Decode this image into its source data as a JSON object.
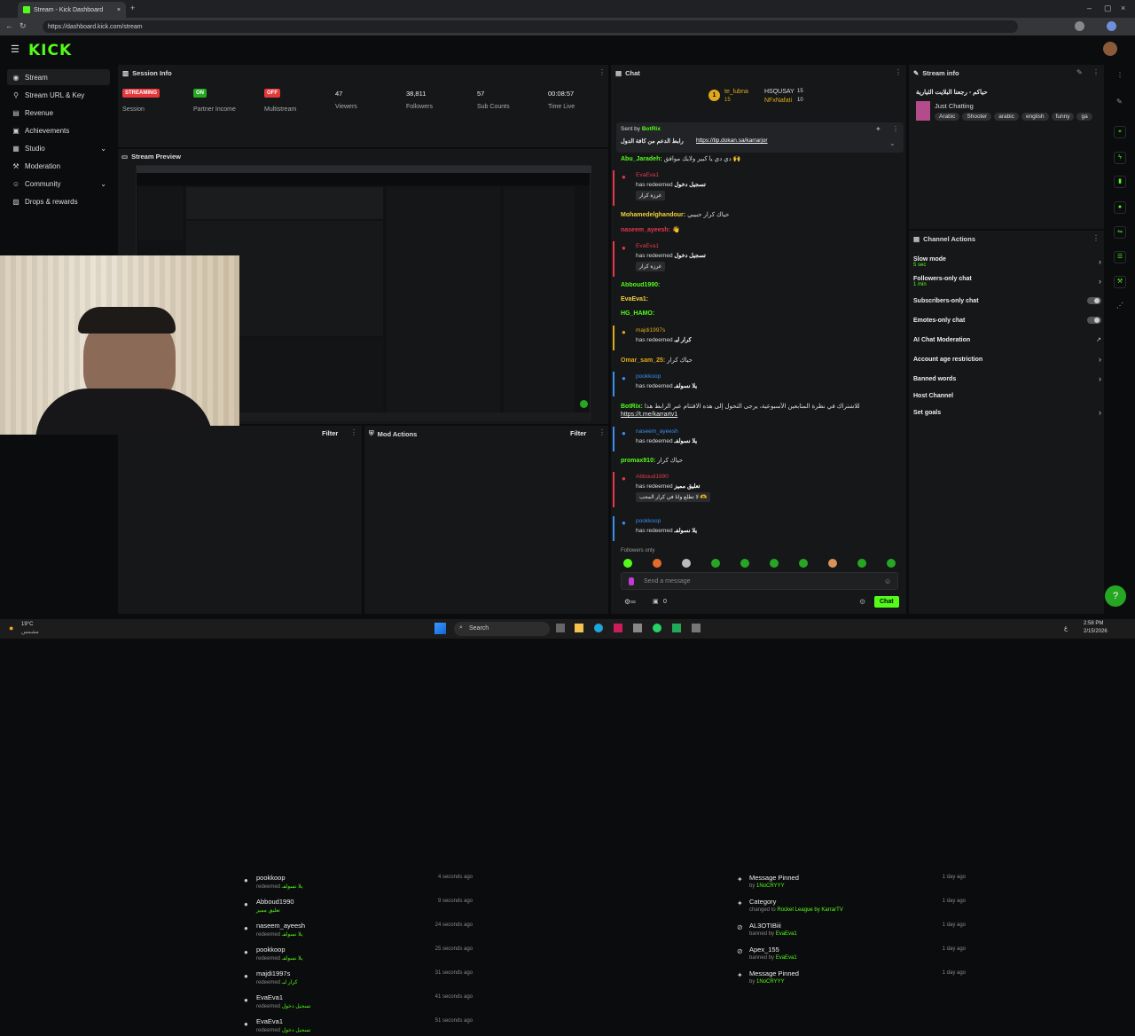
{
  "browser": {
    "tab_title": "Stream - Kick Dashboard",
    "url": "https://dashboard.kick.com/stream"
  },
  "brand": {
    "logo": "KICK",
    "accent": "#53fc18"
  },
  "sidebar": {
    "items": [
      {
        "label": "Stream",
        "icon": "broadcast-icon"
      },
      {
        "label": "Stream URL & Key",
        "icon": "link-icon"
      },
      {
        "label": "Revenue",
        "icon": "money-icon"
      },
      {
        "label": "Achievements",
        "icon": "trophy-icon"
      },
      {
        "label": "Studio",
        "icon": "studio-icon"
      },
      {
        "label": "Moderation",
        "icon": "shield-icon"
      },
      {
        "label": "Community",
        "icon": "people-icon"
      },
      {
        "label": "Drops & rewards",
        "icon": "gift-icon"
      }
    ]
  },
  "session": {
    "title": "Session Info",
    "stats": [
      {
        "badge": "STREAMING",
        "label": "Session"
      },
      {
        "badge": "ON",
        "label": "Partner Income"
      },
      {
        "badge": "OFF",
        "label": "Multistream"
      },
      {
        "value": "47",
        "label": "Viewers"
      },
      {
        "value": "38,811",
        "label": "Followers"
      },
      {
        "value": "57",
        "label": "Sub Counts"
      },
      {
        "value": "00:08:57",
        "label": "Time Live"
      }
    ]
  },
  "preview": {
    "title": "Stream Preview"
  },
  "activity": {
    "filter": "Filter",
    "items": [
      {
        "name": "pookkoop",
        "sub": "redeemed",
        "reward": "يلا نسولفـ",
        "time": "4 seconds ago"
      },
      {
        "name": "Abboud1990",
        "sub": "",
        "reward": "تعليق مميز",
        "time": "9 seconds ago"
      },
      {
        "name": "naseem_ayeesh",
        "sub": "redeemed",
        "reward": "يلا نسولفـ",
        "time": "24 seconds ago"
      },
      {
        "name": "pookkoop",
        "sub": "redeemed",
        "reward": "يلا نسولفـ",
        "time": "25 seconds ago"
      },
      {
        "name": "majdi1997s",
        "sub": "redeemed",
        "reward": "كرار لبـ",
        "time": "31 seconds ago"
      },
      {
        "name": "EvaEva1",
        "sub": "redeemed",
        "reward": "تسجيل دخول",
        "time": "41 seconds ago"
      },
      {
        "name": "EvaEva1",
        "sub": "redeemed",
        "reward": "تسجيل دخول",
        "time": "51 seconds ago"
      }
    ]
  },
  "modactions": {
    "title": "Mod Actions",
    "filter": "Filter",
    "items": [
      {
        "name": "Message Pinned",
        "sub": "by",
        "who": "1NoCRYYY",
        "time": "1 day ago",
        "icon": "pin-icon"
      },
      {
        "name": "Category",
        "sub": "changed to",
        "who": "Rocket League by KarrarTV",
        "time": "1 day ago",
        "icon": "pin-icon"
      },
      {
        "name": "AL3OTIBiii",
        "sub": "banned by",
        "who": "EvaEva1",
        "time": "1 day ago",
        "icon": "ban-icon"
      },
      {
        "name": "Apex_155",
        "sub": "banned by",
        "who": "EvaEva1",
        "time": "1 day ago",
        "icon": "ban-icon"
      },
      {
        "name": "Message Pinned",
        "sub": "by",
        "who": "1NoCRYYY",
        "time": "1 day ago",
        "icon": "pin-icon"
      }
    ]
  },
  "chat": {
    "title": "Chat",
    "top": {
      "rank": "1",
      "u1": "te_lubna",
      "u1n": "15",
      "u2": "HSQUSAY",
      "u2n": "15",
      "u3": "NFxNafati",
      "u3n": "10"
    },
    "pinned": {
      "sent_by": "Sent by",
      "author": "BotRix",
      "text": "رابط الدعم من كافة الدول",
      "link": "https://tip.dokan.sa/karrarjor"
    },
    "lines": [
      {
        "user": "Abu_Jaradeh:",
        "text": "دي دي يا كبير ولايك موافق 🙌"
      },
      {
        "user": "EvaEva1",
        "text": "has redeemed",
        "reward": "تسجيل دخول",
        "chip": "غرزة كرار"
      },
      {
        "user": "Mohamedelghandour:",
        "text": "حياك كرار حبيبي"
      },
      {
        "user": "naseem_ayeesh:",
        "text": "👋"
      },
      {
        "user": "EvaEva1",
        "text": "has redeemed",
        "reward": "تسجيل دخول",
        "chip": "غرزة كرار"
      },
      {
        "user": "Abboud1990:",
        "text": ""
      },
      {
        "user": "EvaEva1:",
        "text": ""
      },
      {
        "user": "HG_HAMO:",
        "text": ""
      },
      {
        "user": "majdi1997s",
        "text": "has redeemed",
        "reward": "كرار لبـ"
      },
      {
        "user": "Omar_sam_25:",
        "text": "حياك كرار"
      },
      {
        "user": "pookkoop",
        "text": "has redeemed",
        "reward": "يلا نسولفـ"
      },
      {
        "user": "BotRix:",
        "text": "للاشتراك في نظرة المتابعين الأسبوعية، يرجى التحول إلى هذه الافتتام عبر الرابط هذا",
        "link": "https://t.me/karrartv1"
      },
      {
        "user": "naseem_ayeesh",
        "text": "has redeemed",
        "reward": "يلا نسولفـ"
      },
      {
        "user": "promax910:",
        "text": "حياك كرار"
      },
      {
        "user": "Abboud1990",
        "text": "has redeemed",
        "reward": "تعليق مميز",
        "chip": "لا تطلع وانا في كرار المحب 🫶"
      },
      {
        "user": "pookkoop",
        "text": "has redeemed",
        "reward": "يلا نسولفـ"
      }
    ],
    "followers_only": "Followers only",
    "placeholder": "Send a message",
    "count": "0",
    "send": "Chat"
  },
  "streaminfo": {
    "title": "Stream info",
    "stream_title": "حياكم - رجعنا البلايت الثيارية",
    "category": "Just Chatting",
    "tags": [
      "Arabic",
      "Shooter",
      "arabic",
      "english",
      "funny",
      "ga"
    ]
  },
  "channelactions": {
    "title": "Channel Actions",
    "rows": [
      {
        "label": "Slow mode",
        "sub": "5 sec",
        "ctl": "chevron"
      },
      {
        "label": "Followers-only chat",
        "sub": "1 min",
        "ctl": "chevron"
      },
      {
        "label": "Subscribers-only chat",
        "sub": "",
        "ctl": "toggle"
      },
      {
        "label": "Emotes-only chat",
        "sub": "",
        "ctl": "toggle"
      },
      {
        "label": "AI Chat Moderation",
        "sub": "",
        "ctl": "ext"
      },
      {
        "label": "Account age restriction",
        "sub": "",
        "ctl": "chevron"
      },
      {
        "label": "Banned words",
        "sub": "",
        "ctl": "chevron"
      },
      {
        "label": "Host Channel",
        "sub": "",
        "ctl": ""
      },
      {
        "label": "Set goals",
        "sub": "",
        "ctl": "chevron"
      }
    ]
  },
  "taskbar": {
    "weather": "19°C",
    "weather_sub": "مشمس",
    "search": "Search",
    "time": "2:58 PM",
    "date": "2/15/2026",
    "lang": "ع"
  }
}
